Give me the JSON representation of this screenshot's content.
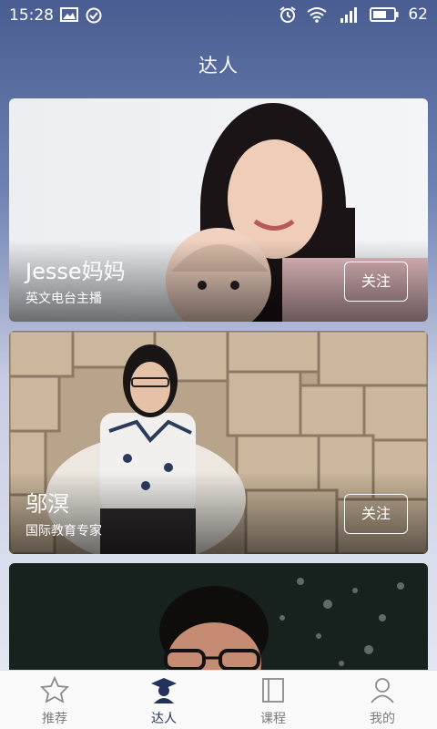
{
  "status": {
    "time": "15:28",
    "battery": "62"
  },
  "header": {
    "title": "达人"
  },
  "cards": [
    {
      "name": "Jesse妈妈",
      "desc": "英文电台主播",
      "follow_label": "关注"
    },
    {
      "name": "邬溟",
      "desc": "国际教育专家",
      "follow_label": "关注"
    },
    {
      "name": "",
      "desc": "",
      "follow_label": ""
    }
  ],
  "tabs": [
    {
      "label": "推荐",
      "icon": "star-icon"
    },
    {
      "label": "达人",
      "icon": "graduate-icon"
    },
    {
      "label": "课程",
      "icon": "book-icon"
    },
    {
      "label": "我的",
      "icon": "user-icon"
    }
  ],
  "colors": {
    "accent": "#22325a",
    "tab_inactive": "#7b7b7b"
  }
}
